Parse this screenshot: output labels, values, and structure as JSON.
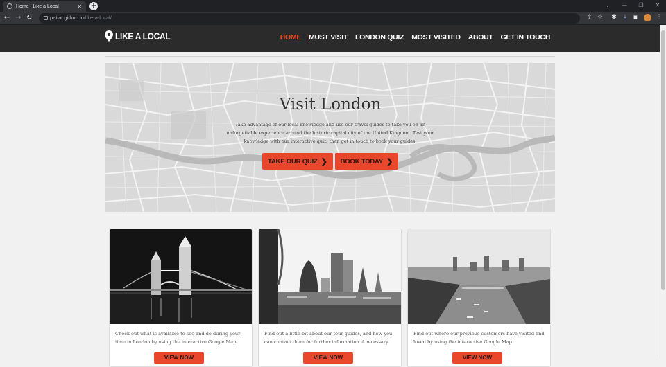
{
  "browser": {
    "tab_title": "Home | Like a Local",
    "tab_close": "✕",
    "new_tab": "+",
    "url_domain": "patiat.github.io",
    "url_path": "/like-a-local/",
    "nav": {
      "back": "←",
      "forward": "→",
      "reload": "↻"
    }
  },
  "site": {
    "brand": "LIKE A LOCAL",
    "nav_links": [
      "HOME",
      "MUST VISIT",
      "LONDON QUIZ",
      "MOST VISITED",
      "ABOUT",
      "GET IN TOUCH"
    ],
    "active_link": "HOME"
  },
  "hero": {
    "title": "Visit London",
    "text": "Take advantage of our local knowledge and use our travel guides to take you on an unforgettable experience around the historic capital city of the United Kingdom. Test your knowledge with our interactive quiz, then get in touch to book your guides.",
    "buttons": [
      "TAKE OUR QUIZ",
      "BOOK TODAY"
    ]
  },
  "cards": [
    {
      "text": "Check out what is available to see and do during your time in London by using the interactive Google Map.",
      "button": "VIEW NOW"
    },
    {
      "text": "Find out a little bit about our tour guides, and how you can contact them for further information if necessary.",
      "button": "VIEW NOW"
    },
    {
      "text": "Find out where our previous customers have visited and loved by using the interactive Google Map.",
      "button": "VIEW NOW"
    }
  ],
  "colors": {
    "accent": "#e8472b",
    "navbar": "#2b2b2b",
    "page_bg": "#f1f1f1"
  }
}
